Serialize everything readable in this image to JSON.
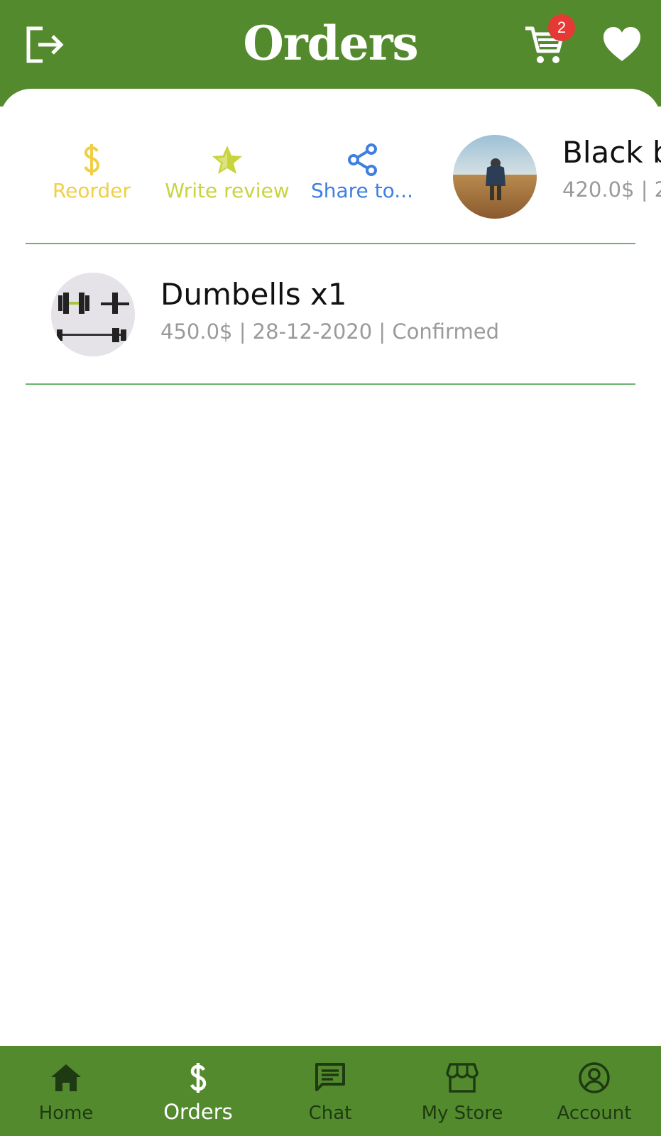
{
  "header": {
    "title": "Orders",
    "cart_badge": "2",
    "icons": {
      "logout": "logout-icon",
      "cart": "cart-icon",
      "favorite": "heart-icon"
    },
    "background": "#548a2e"
  },
  "swipe_actions": [
    {
      "label": "Reorder",
      "icon": "dollar-icon",
      "color": "#f0cf47"
    },
    {
      "label": "Write review",
      "icon": "star-icon",
      "color": "#c8d43d"
    },
    {
      "label": "Share to...",
      "icon": "share-icon",
      "color": "#3f7fe0"
    }
  ],
  "orders": [
    {
      "title": "Black b",
      "meta": "420.0$  |  2"
    },
    {
      "title": "Dumbells  x1",
      "meta": "450.0$  |  28-12-2020  |  Confirmed"
    }
  ],
  "bottom_nav": [
    {
      "label": "Home",
      "icon": "home-icon"
    },
    {
      "label": "Orders",
      "icon": "dollar-icon",
      "active": true
    },
    {
      "label": "Chat",
      "icon": "chat-icon"
    },
    {
      "label": "My Store",
      "icon": "store-icon"
    },
    {
      "label": "Account",
      "icon": "account-icon"
    }
  ],
  "colors": {
    "divider": "#6bb36b",
    "badge": "#e53935",
    "meta_text": "#9a9a9a"
  }
}
